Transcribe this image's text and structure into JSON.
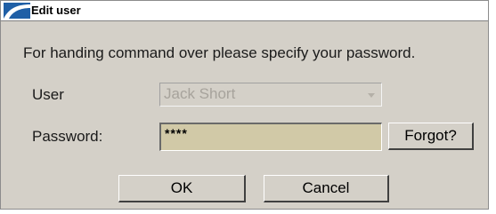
{
  "window": {
    "title": "Edit user",
    "icon": "app-wave-icon"
  },
  "message": "For handing command over please specify your password.",
  "user": {
    "label": "User",
    "value": "Jack Short"
  },
  "password": {
    "label": "Password:",
    "value": "****"
  },
  "buttons": {
    "forgot": "Forgot?",
    "ok": "OK",
    "cancel": "Cancel"
  }
}
